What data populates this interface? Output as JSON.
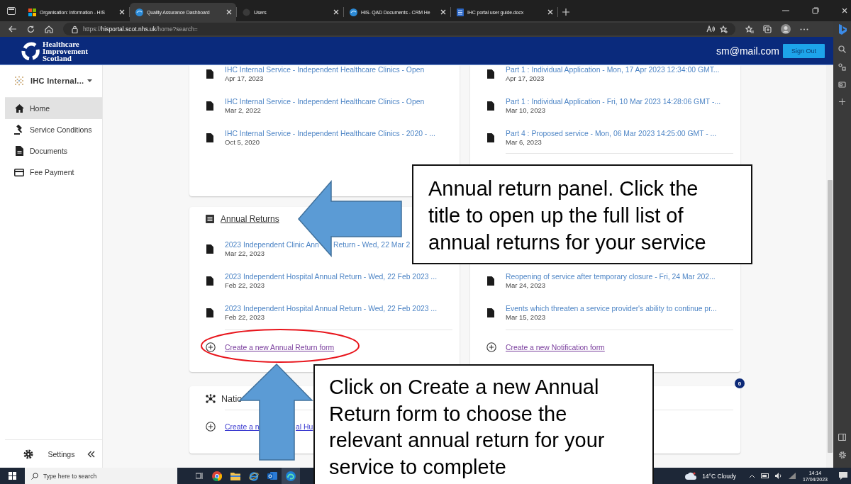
{
  "browser": {
    "tabs": [
      {
        "title": "Organisation: Information - HIS",
        "kind": "squares",
        "selected": false
      },
      {
        "title": "Quality Assurance Dashboard",
        "kind": "round",
        "selected": true
      },
      {
        "title": "Users",
        "kind": "blank",
        "selected": false
      },
      {
        "title": "HIS- QAD Documents - CRM He",
        "kind": "round",
        "selected": false
      },
      {
        "title": "IHC portal user guide.docx",
        "kind": "word",
        "selected": false
      }
    ],
    "address": "https://**hisportal.scot.nhs.uk**/home?search="
  },
  "header": {
    "logo": [
      "Healthcare",
      "Improvement",
      "Scotland"
    ],
    "user": "sm@mail.com",
    "sign_out": "Sign Out"
  },
  "sidebar": {
    "service": "IHC Internal...",
    "items": [
      {
        "label": "Home",
        "kind": "home",
        "selected": true
      },
      {
        "label": "Service Conditions",
        "kind": "gavel",
        "selected": false
      },
      {
        "label": "Documents",
        "kind": "document",
        "selected": false
      },
      {
        "label": "Fee Payment",
        "kind": "card",
        "selected": false
      }
    ],
    "settings": "Settings"
  },
  "left_column": [
    {
      "divider": false,
      "items": [
        {
          "title": "IHC Internal Service - Independent Healthcare Clinics - Open",
          "date": "Apr 17, 2023"
        },
        {
          "title": "IHC Internal Service - Independent Healthcare Clinics - Open",
          "date": "Mar 2, 2022"
        },
        {
          "title": "IHC Internal Service - Independent Healthcare Clinics - 2020 - ...",
          "date": "Oct 5, 2020"
        }
      ]
    },
    {
      "title": "Annual Returns",
      "kind": "list",
      "divider": true,
      "items": [
        {
          "title_parts": [
            "2023 Independent Clinic Ann",
            "Return - Wed, 22 Mar 2"
          ],
          "date": "Mar 22, 2023"
        },
        {
          "title": "2023 Independent Hospital Annual Return - Wed, 22 Feb 2023 ...",
          "date": "Feb 22, 2023"
        },
        {
          "title": "2023 Independent Hospital Annual Return - Wed, 22 Feb 2023 ...",
          "date": "Feb 22, 2023"
        }
      ],
      "create_link": {
        "parts": [
          "Create a new Annual Return form"
        ],
        "visited": true
      }
    },
    {
      "title": "Natio",
      "kind": "hub",
      "divider": true,
      "create_link": {
        "parts": [
          "Create a n",
          "al Hu"
        ],
        "visited": false
      }
    }
  ],
  "right_column": [
    {
      "divider": true,
      "items": [
        {
          "title": "Part 1 : Individual Application - Mon, 17 Apr 2023 12:34:00 GMT...",
          "date": "Apr 17, 2023"
        },
        {
          "title": "Part 1 : Individual Application - Fri, 10 Mar 2023 14:28:06 GMT -...",
          "date": "Mar 10, 2023"
        },
        {
          "title": "Part 4 : Proposed service - Mon, 06 Mar 2023 14:25:00 GMT - ...",
          "date": "Mar 6, 2023"
        }
      ]
    },
    {
      "divider": true,
      "items": [
        {
          "title": "Reopening of service after temporary closure - Fri, 24 Mar 202...",
          "date": "Mar 24, 2023"
        },
        {
          "title": "Events which threaten a service provider's ability to continue pr...",
          "date": "Mar 15, 2023"
        }
      ],
      "create_link": {
        "parts": [
          "Create a new Notification form"
        ],
        "visited": true
      }
    },
    {
      "divider": true,
      "badge": "0"
    }
  ],
  "taskbar": {
    "search_placeholder": "Type here to search",
    "weather": "14°C Cloudy",
    "time": "14:14",
    "date": "17/04/2023"
  },
  "annotations": [
    {
      "text": "Annual return panel. Click the title to open up the full list of annual returns for your service"
    },
    {
      "text": "Click on Create a new Annual Return form to choose the relevant annual return for your service to complete"
    }
  ]
}
